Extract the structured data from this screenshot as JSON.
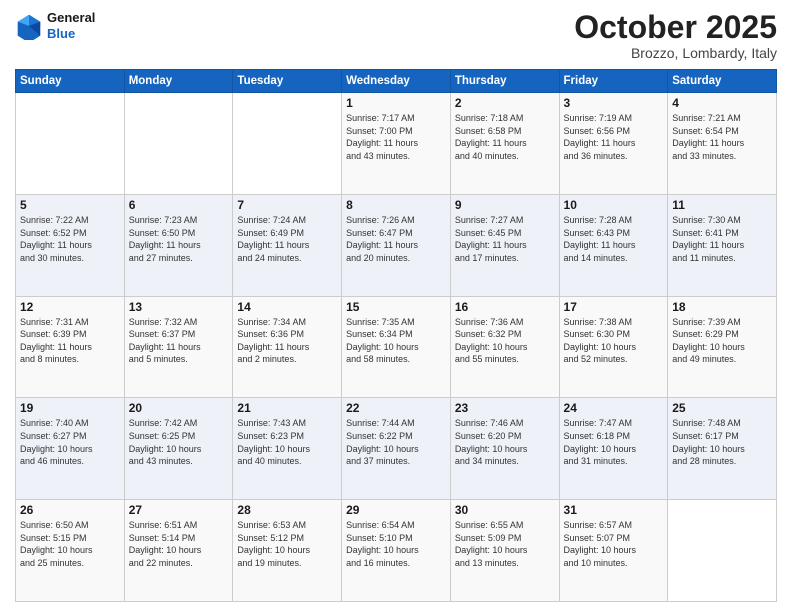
{
  "header": {
    "logo": {
      "line1": "General",
      "line2": "Blue"
    },
    "title": "October 2025",
    "subtitle": "Brozzo, Lombardy, Italy"
  },
  "weekdays": [
    "Sunday",
    "Monday",
    "Tuesday",
    "Wednesday",
    "Thursday",
    "Friday",
    "Saturday"
  ],
  "weeks": [
    [
      {
        "day": "",
        "info": ""
      },
      {
        "day": "",
        "info": ""
      },
      {
        "day": "",
        "info": ""
      },
      {
        "day": "1",
        "info": "Sunrise: 7:17 AM\nSunset: 7:00 PM\nDaylight: 11 hours\nand 43 minutes."
      },
      {
        "day": "2",
        "info": "Sunrise: 7:18 AM\nSunset: 6:58 PM\nDaylight: 11 hours\nand 40 minutes."
      },
      {
        "day": "3",
        "info": "Sunrise: 7:19 AM\nSunset: 6:56 PM\nDaylight: 11 hours\nand 36 minutes."
      },
      {
        "day": "4",
        "info": "Sunrise: 7:21 AM\nSunset: 6:54 PM\nDaylight: 11 hours\nand 33 minutes."
      }
    ],
    [
      {
        "day": "5",
        "info": "Sunrise: 7:22 AM\nSunset: 6:52 PM\nDaylight: 11 hours\nand 30 minutes."
      },
      {
        "day": "6",
        "info": "Sunrise: 7:23 AM\nSunset: 6:50 PM\nDaylight: 11 hours\nand 27 minutes."
      },
      {
        "day": "7",
        "info": "Sunrise: 7:24 AM\nSunset: 6:49 PM\nDaylight: 11 hours\nand 24 minutes."
      },
      {
        "day": "8",
        "info": "Sunrise: 7:26 AM\nSunset: 6:47 PM\nDaylight: 11 hours\nand 20 minutes."
      },
      {
        "day": "9",
        "info": "Sunrise: 7:27 AM\nSunset: 6:45 PM\nDaylight: 11 hours\nand 17 minutes."
      },
      {
        "day": "10",
        "info": "Sunrise: 7:28 AM\nSunset: 6:43 PM\nDaylight: 11 hours\nand 14 minutes."
      },
      {
        "day": "11",
        "info": "Sunrise: 7:30 AM\nSunset: 6:41 PM\nDaylight: 11 hours\nand 11 minutes."
      }
    ],
    [
      {
        "day": "12",
        "info": "Sunrise: 7:31 AM\nSunset: 6:39 PM\nDaylight: 11 hours\nand 8 minutes."
      },
      {
        "day": "13",
        "info": "Sunrise: 7:32 AM\nSunset: 6:37 PM\nDaylight: 11 hours\nand 5 minutes."
      },
      {
        "day": "14",
        "info": "Sunrise: 7:34 AM\nSunset: 6:36 PM\nDaylight: 11 hours\nand 2 minutes."
      },
      {
        "day": "15",
        "info": "Sunrise: 7:35 AM\nSunset: 6:34 PM\nDaylight: 10 hours\nand 58 minutes."
      },
      {
        "day": "16",
        "info": "Sunrise: 7:36 AM\nSunset: 6:32 PM\nDaylight: 10 hours\nand 55 minutes."
      },
      {
        "day": "17",
        "info": "Sunrise: 7:38 AM\nSunset: 6:30 PM\nDaylight: 10 hours\nand 52 minutes."
      },
      {
        "day": "18",
        "info": "Sunrise: 7:39 AM\nSunset: 6:29 PM\nDaylight: 10 hours\nand 49 minutes."
      }
    ],
    [
      {
        "day": "19",
        "info": "Sunrise: 7:40 AM\nSunset: 6:27 PM\nDaylight: 10 hours\nand 46 minutes."
      },
      {
        "day": "20",
        "info": "Sunrise: 7:42 AM\nSunset: 6:25 PM\nDaylight: 10 hours\nand 43 minutes."
      },
      {
        "day": "21",
        "info": "Sunrise: 7:43 AM\nSunset: 6:23 PM\nDaylight: 10 hours\nand 40 minutes."
      },
      {
        "day": "22",
        "info": "Sunrise: 7:44 AM\nSunset: 6:22 PM\nDaylight: 10 hours\nand 37 minutes."
      },
      {
        "day": "23",
        "info": "Sunrise: 7:46 AM\nSunset: 6:20 PM\nDaylight: 10 hours\nand 34 minutes."
      },
      {
        "day": "24",
        "info": "Sunrise: 7:47 AM\nSunset: 6:18 PM\nDaylight: 10 hours\nand 31 minutes."
      },
      {
        "day": "25",
        "info": "Sunrise: 7:48 AM\nSunset: 6:17 PM\nDaylight: 10 hours\nand 28 minutes."
      }
    ],
    [
      {
        "day": "26",
        "info": "Sunrise: 6:50 AM\nSunset: 5:15 PM\nDaylight: 10 hours\nand 25 minutes."
      },
      {
        "day": "27",
        "info": "Sunrise: 6:51 AM\nSunset: 5:14 PM\nDaylight: 10 hours\nand 22 minutes."
      },
      {
        "day": "28",
        "info": "Sunrise: 6:53 AM\nSunset: 5:12 PM\nDaylight: 10 hours\nand 19 minutes."
      },
      {
        "day": "29",
        "info": "Sunrise: 6:54 AM\nSunset: 5:10 PM\nDaylight: 10 hours\nand 16 minutes."
      },
      {
        "day": "30",
        "info": "Sunrise: 6:55 AM\nSunset: 5:09 PM\nDaylight: 10 hours\nand 13 minutes."
      },
      {
        "day": "31",
        "info": "Sunrise: 6:57 AM\nSunset: 5:07 PM\nDaylight: 10 hours\nand 10 minutes."
      },
      {
        "day": "",
        "info": ""
      }
    ]
  ]
}
